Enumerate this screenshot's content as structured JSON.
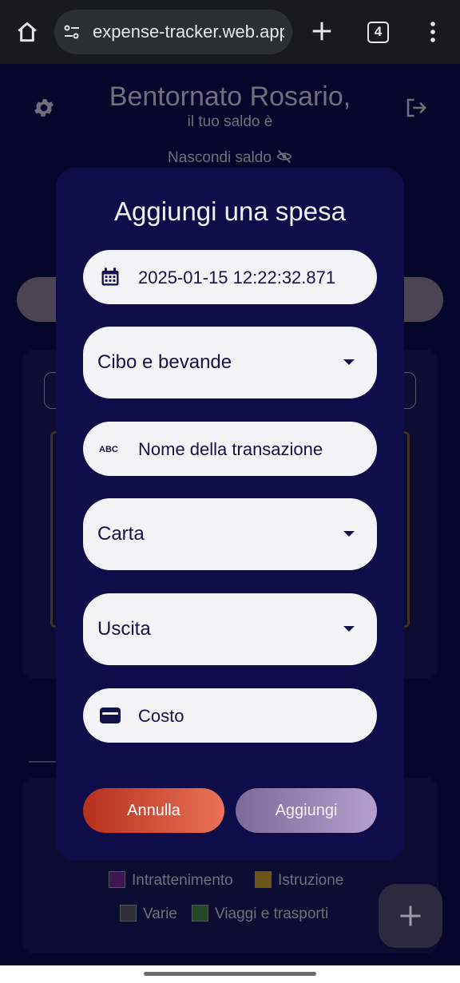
{
  "browser": {
    "url": "expense-tracker.web.app",
    "tab_count": "4",
    "home_icon": "home-icon",
    "site_settings_icon": "tune-icon",
    "new_tab_icon": "plus-icon",
    "menu_icon": "more-vert-icon"
  },
  "header": {
    "greeting": "Bentornato Rosario,",
    "balance_caption": "il tuo saldo è",
    "hide_balance_label": "Nascondi saldo",
    "settings_icon": "gear-icon",
    "logout_icon": "logout-icon",
    "hide_icon": "eye-off-icon"
  },
  "legend": {
    "items": [
      {
        "label": "Intrattenimento",
        "color": "#3d1850"
      },
      {
        "label": "Istruzione",
        "color": "#6a5418"
      },
      {
        "label": "Varie",
        "color": "#2f2f35"
      },
      {
        "label": "Viaggi e trasporti",
        "color": "#1f4a22"
      }
    ]
  },
  "fab": {
    "icon": "plus-icon"
  },
  "dialog": {
    "title": "Aggiungi una spesa",
    "date_value": "2025-01-15 12:22:32.871",
    "date_icon": "calendar-icon",
    "category_value": "Cibo e bevande",
    "name_placeholder": "Nome della transazione",
    "name_icon": "abc-icon",
    "payment_value": "Carta",
    "type_value": "Uscita",
    "cost_placeholder": "Costo",
    "cost_icon": "wallet-icon",
    "cancel_label": "Annulla",
    "add_label": "Aggiungi"
  },
  "colors": {
    "background": "#05042a",
    "dialog": "#0f0c4a",
    "field": "#f4f4f6",
    "cancel_button": "#d3503a",
    "add_button": "#9a86b4"
  }
}
